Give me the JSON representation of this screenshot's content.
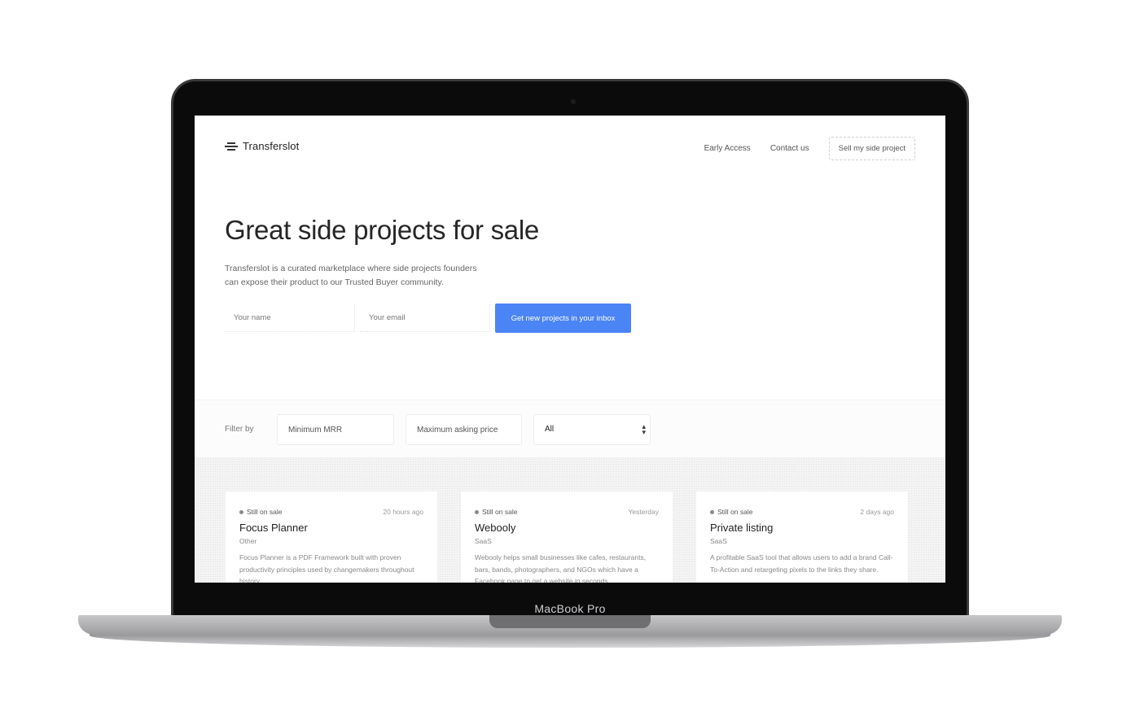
{
  "device": {
    "label": "MacBook Pro"
  },
  "nav": {
    "logo_text": "Transferslot",
    "links": [
      "Early Access",
      "Contact us"
    ],
    "cta": "Sell my side project"
  },
  "hero": {
    "title": "Great side projects for sale",
    "subtitle_line1": "Transferslot is a curated marketplace where side projects founders",
    "subtitle_line2": "can expose their product to our Trusted Buyer community.",
    "name_placeholder": "Your name",
    "email_placeholder": "Your email",
    "cta": "Get new projects in your inbox"
  },
  "filters": {
    "label": "Filter by",
    "min_mrr_placeholder": "Minimum MRR",
    "max_price_placeholder": "Maximum asking price",
    "category_selected": "All"
  },
  "listings": [
    {
      "status": "Still on sale",
      "time": "20 hours ago",
      "title": "Focus Planner",
      "category": "Other",
      "description": "Focus Planner is a PDF Framework built with proven productivity principles used by changemakers throughout history."
    },
    {
      "status": "Still on sale",
      "time": "Yesterday",
      "title": "Webooly",
      "category": "SaaS",
      "description": "Webooly helps small businesses like cafes, restaurants, bars, bands, photographers, and NGOs which have a Facebook page to get a website in seconds."
    },
    {
      "status": "Still on sale",
      "time": "2 days ago",
      "title": "Private listing",
      "category": "SaaS",
      "description": "A profitable SaaS tool that allows users to add a brand Call-To-Action and retargeting pixels to the links they share."
    }
  ],
  "colors": {
    "accent": "#4b84f5",
    "status_dot": "#8a8a8a"
  }
}
